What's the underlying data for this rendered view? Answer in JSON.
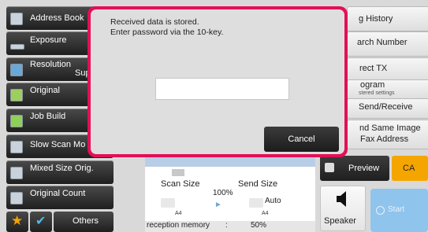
{
  "left_menu": [
    {
      "label": "Address Book",
      "icon": "address-book-icon"
    },
    {
      "label": "Exposure",
      "icon": "exposure-icon"
    },
    {
      "label": "Resolution",
      "sub": "Sup",
      "icon": "resolution-icon"
    },
    {
      "label": "Original",
      "icon": "original-icon"
    },
    {
      "label": "Job Build",
      "icon": "job-build-icon"
    },
    {
      "label": "Slow Scan Mo",
      "icon": "slow-scan-icon"
    },
    {
      "label": "Mixed Size Orig.",
      "icon": "mixed-size-icon"
    },
    {
      "label": "Original Count",
      "icon": "original-count-icon"
    }
  ],
  "bottom_left": {
    "others_label": "Others"
  },
  "right_menu": [
    {
      "label": "g History"
    },
    {
      "label": "arch Number"
    },
    {
      "label": "rect TX"
    },
    {
      "label": "ogram",
      "sub": "stered settings"
    },
    {
      "label": "Send/Receive"
    },
    {
      "label": "nd Same Image",
      "line2": "Fax Address"
    }
  ],
  "dialog": {
    "message_line1": "Received data is stored.",
    "message_line2": "Enter password via the 10-key.",
    "password_value": "",
    "cancel_label": "Cancel"
  },
  "scan_panel": {
    "scan_size_label": "Scan Size",
    "send_size_label": "Send Size",
    "percent": "100%",
    "auto_label": "Auto",
    "scan_paper": "A4",
    "send_paper": "A4",
    "memory_label": "reception memory",
    "memory_sep": ":",
    "memory_value": "50%"
  },
  "preview_label": "Preview",
  "ca_label": "CA",
  "speaker_label": "Speaker",
  "start_label": "Start",
  "colors": {
    "dialog_border": "#e30f57",
    "ca_button": "#f5a500",
    "start_button": "#8fc4ec"
  }
}
